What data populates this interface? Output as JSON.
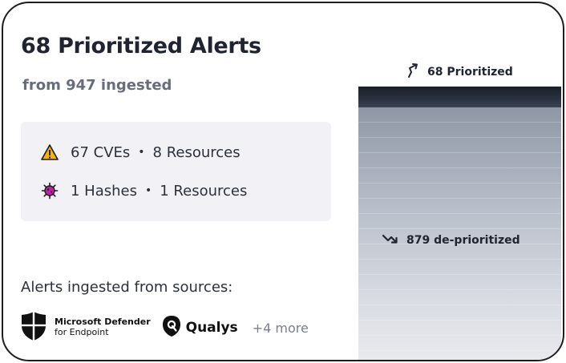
{
  "header": {
    "title": "68 Prioritized Alerts",
    "subtitle": "from 947 ingested"
  },
  "summary": {
    "cve_row": {
      "icon": "warning-icon",
      "primary": "67 CVEs",
      "separator": "•",
      "secondary": "8 Resources"
    },
    "hash_row": {
      "icon": "virus-icon",
      "primary": "1 Hashes",
      "separator": "•",
      "secondary": "1 Resources"
    }
  },
  "sources": {
    "label": "Alerts ingested from sources:",
    "microsoft": {
      "name": "Microsoft Defender",
      "sub": "for Endpoint",
      "icon": "microsoft-defender-shield-icon"
    },
    "qualys": {
      "name": "Qualys",
      "icon": "qualys-logo-icon"
    },
    "more": "+4 more"
  },
  "funnel": {
    "prioritized_label": "68 Prioritized",
    "prioritized_icon": "trend-up-arrow-icon",
    "deprioritized_label": "879 de-prioritized",
    "deprioritized_icon": "trend-down-arrow-icon",
    "prioritized_count": 68,
    "total_count": 947
  },
  "colors": {
    "title": "#1f2430",
    "subtitle": "#676d7b",
    "summary_bg": "#f2f2f6",
    "warning": "#f5b400",
    "virus": "#c21fa8",
    "bar_dark": "#1a1f29",
    "bar_light": "#b9bfca"
  }
}
